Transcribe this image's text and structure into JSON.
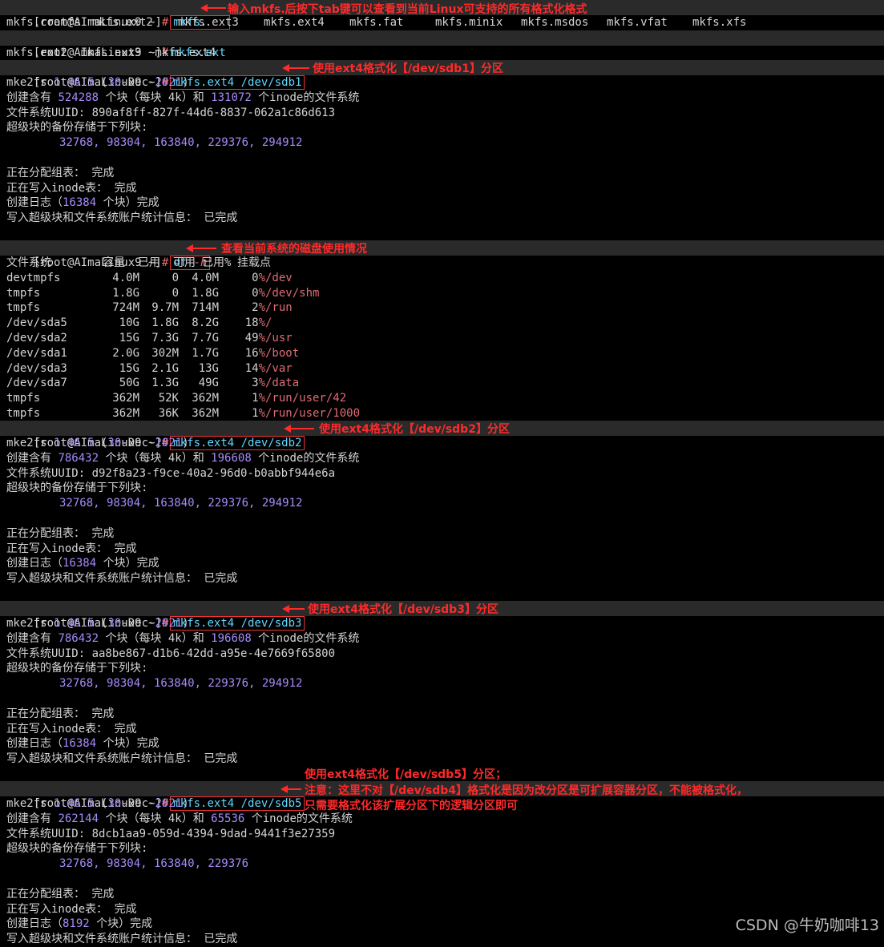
{
  "prompt": "[root@AImaLinux9 ~]",
  "hash": "#",
  "commands": {
    "c1": "mkfs.",
    "c2": "mkfs.ext",
    "c3": "mkfs.ext4 /dev/sdb1",
    "c4_cmd": "df",
    "c4_opt": "-h",
    "c5": "mkfs.ext4 /dev/sdb2",
    "c6": "mkfs.ext4 /dev/sdb3",
    "c7": "mkfs.ext4 /dev/sdb5"
  },
  "tab_completion_1": [
    "mkfs.cramfs",
    "mkfs.ext2",
    "mkfs.ext3",
    "mkfs.ext4",
    "mkfs.fat",
    "mkfs.minix",
    "mkfs.msdos",
    "mkfs.vfat",
    "mkfs.xfs"
  ],
  "tab_completion_2": "mkfs.ext2  mkfs.ext3  mkfs.ext4",
  "annotations": {
    "a1": "输入mkfs.后按下tab键可以查看到当前Linux可支持的所有格式化格式",
    "a2": "使用ext4格式化【/dev/sdb1】分区",
    "a3": "查看当前系统的磁盘使用情况",
    "a4": "使用ext4格式化【/dev/sdb2】分区",
    "a5": "使用ext4格式化【/dev/sdb3】分区",
    "a6_l1": "使用ext4格式化【/dev/sdb5】分区；",
    "a6_l2": "注意：这里不对【/dev/sdb4】格式化是因为改分区是可扩展容器分区，不能被格式化，",
    "a6_l3": "只需要格式化该扩展分区下的逻辑分区即可"
  },
  "mke2fs": {
    "prefix": "mke2fs ",
    "version": "1.46.5",
    "date_open": " (",
    "date_day": "30",
    "date_rest": "-Dec-",
    "date_year": "2021",
    "date_close": ")"
  },
  "fmt_text": {
    "create_prefix": "创建含有 ",
    "blocks_mid": " 个块（每块 4k）和 ",
    "inodes_suffix": " 个inode的文件系统",
    "uuid_prefix": "文件系统UUID: ",
    "backup_label": "超级块的备份存储于下列块:",
    "alloc_groups": "正在分配组表： 完成",
    "write_inode": "正在写入inode表： 完成",
    "journal_prefix": "创建日志（",
    "journal_suffix": " 个块）完成",
    "write_super": "写入超级块和文件系统账户统计信息： 已完成"
  },
  "sdb1": {
    "blocks": "524288",
    "inodes": "131072",
    "uuid": "890af8ff-827f-44d6-8837-062a1c86d613",
    "backups": "32768, 98304, 163840, 229376, 294912",
    "journal": "16384"
  },
  "sdb2": {
    "blocks": "786432",
    "inodes": "196608",
    "uuid": "d92f8a23-f9ce-40a2-96d0-b0abbf944e6a",
    "backups": "32768, 98304, 163840, 229376, 294912",
    "journal": "16384"
  },
  "sdb3": {
    "blocks": "786432",
    "inodes": "196608",
    "uuid": "aa8be867-d1b6-42dd-a95e-4e7669f65800",
    "backups": "32768, 98304, 163840, 229376, 294912",
    "journal": "16384"
  },
  "sdb5": {
    "blocks": "262144",
    "inodes": "65536",
    "uuid": "8dcb1aa9-059d-4394-9dad-9441f3e27359",
    "backups": "32768, 98304, 163840, 229376",
    "journal": "8192"
  },
  "df": {
    "header": {
      "fs": "文件系统",
      "size": "容量",
      "used": "已用",
      "avail": "可用",
      "pct": "已用%",
      "mount": "挂载点"
    },
    "rows": [
      {
        "fs": "devtmpfs",
        "size": "4.0M",
        "used": "0",
        "avail": "4.0M",
        "pct": "0",
        "mount": "/dev"
      },
      {
        "fs": "tmpfs",
        "size": "1.8G",
        "used": "0",
        "avail": "1.8G",
        "pct": "0",
        "mount": "/dev/shm"
      },
      {
        "fs": "tmpfs",
        "size": "724M",
        "used": "9.7M",
        "avail": "714M",
        "pct": "2",
        "mount": "/run"
      },
      {
        "fs": "/dev/sda5",
        "size": "10G",
        "used": "1.8G",
        "avail": "8.2G",
        "pct": "18",
        "mount": "/"
      },
      {
        "fs": "/dev/sda2",
        "size": "15G",
        "used": "7.3G",
        "avail": "7.7G",
        "pct": "49",
        "mount": "/usr"
      },
      {
        "fs": "/dev/sda1",
        "size": "2.0G",
        "used": "302M",
        "avail": "1.7G",
        "pct": "16",
        "mount": "/boot"
      },
      {
        "fs": "/dev/sda3",
        "size": "15G",
        "used": "2.1G",
        "avail": "13G",
        "pct": "14",
        "mount": "/var"
      },
      {
        "fs": "/dev/sda7",
        "size": "50G",
        "used": "1.3G",
        "avail": "49G",
        "pct": "3",
        "mount": "/data"
      },
      {
        "fs": "tmpfs",
        "size": "362M",
        "used": "52K",
        "avail": "362M",
        "pct": "1",
        "mount": "/run/user/42"
      },
      {
        "fs": "tmpfs",
        "size": "362M",
        "used": "36K",
        "avail": "362M",
        "pct": "1",
        "mount": "/run/user/1000"
      }
    ],
    "pct_sign": "%"
  },
  "watermark": "CSDN @牛奶咖啡13",
  "colors": {
    "annotation": "#ff2a2a",
    "command": "#5fd7ff",
    "number": "#a78bfa",
    "hash": "#e06c75",
    "background": "#000000"
  }
}
